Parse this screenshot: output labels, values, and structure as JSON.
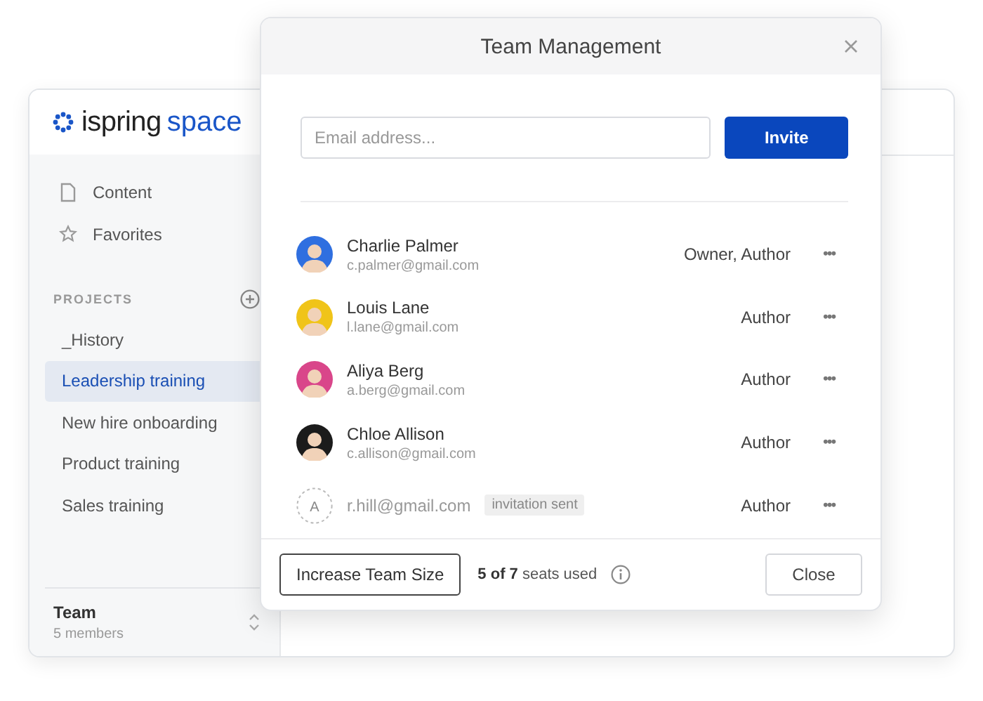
{
  "logo": {
    "brand": "ispring",
    "product": "space"
  },
  "sidebar": {
    "items": [
      {
        "label": "Content",
        "kind": "document"
      },
      {
        "label": "Favorites",
        "kind": "star"
      }
    ],
    "projects_heading": "PROJECTS",
    "projects": [
      {
        "label": "_History",
        "selected": false
      },
      {
        "label": "Leadership training",
        "selected": true
      },
      {
        "label": "New hire onboarding",
        "selected": false
      },
      {
        "label": "Product training",
        "selected": false
      },
      {
        "label": "Sales training",
        "selected": false
      }
    ],
    "team": {
      "title": "Team",
      "count": "5 members"
    }
  },
  "dialog": {
    "title": "Team Management",
    "email": {
      "placeholder": "Email address..."
    },
    "invite_button": "Invite",
    "members": [
      {
        "kind": "user",
        "name": "Charlie Palmer",
        "email": "c.palmer@gmail.com",
        "role": "Owner, Author",
        "color": "#2f6fe0"
      },
      {
        "kind": "user",
        "name": "Louis Lane",
        "email": "l.lane@gmail.com",
        "role": "Author",
        "color": "#f0c419"
      },
      {
        "kind": "user",
        "name": "Aliya Berg",
        "email": "a.berg@gmail.com",
        "role": "Author",
        "color": "#d9468a"
      },
      {
        "kind": "user",
        "name": "Chloe Allison",
        "email": "c.allison@gmail.com",
        "role": "Author",
        "color": "#1b1b1b"
      },
      {
        "kind": "pending",
        "initial": "A",
        "email": "r.hill@gmail.com",
        "badge": "invitation sent",
        "role": "Author"
      }
    ],
    "more": "•••",
    "increase_button": "Increase Team Size",
    "seats": "**5 of 7** seats used",
    "close_button": "Close"
  }
}
